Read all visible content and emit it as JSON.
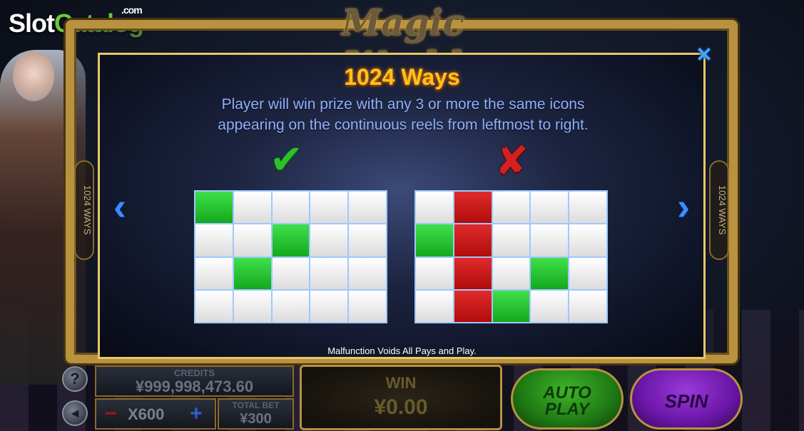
{
  "site_logo": {
    "slot": "Slot",
    "catalog": "Catalog",
    "com": ".com"
  },
  "game": {
    "title": "Magic World"
  },
  "side_label": "1024 WAYS",
  "panel": {
    "close_icon": "×",
    "title": "1024 Ways",
    "description_line1": "Player will win prize with any 3 or more the same icons",
    "description_line2": "appearing on the continuous reels from leftmost to right.",
    "valid_icon": "✔",
    "invalid_icon": "✘",
    "prev_icon": "‹",
    "next_icon": "›",
    "valid_grid": [
      [
        "g",
        "w",
        "w",
        "w",
        "w"
      ],
      [
        "w",
        "w",
        "g",
        "w",
        "w"
      ],
      [
        "w",
        "g",
        "w",
        "w",
        "w"
      ],
      [
        "w",
        "w",
        "w",
        "w",
        "w"
      ]
    ],
    "invalid_grid": [
      [
        "w",
        "r",
        "w",
        "w",
        "w"
      ],
      [
        "g",
        "r",
        "w",
        "w",
        "w"
      ],
      [
        "w",
        "r",
        "w",
        "g",
        "w"
      ],
      [
        "w",
        "r",
        "g",
        "w",
        "w"
      ]
    ],
    "disclaimer": "Malfunction Voids All Pays and Play."
  },
  "controls": {
    "help_icon": "?",
    "sound_icon": "◄",
    "credits_label": "CREDITS",
    "credits_value": "¥999,998,473.60",
    "bet_minus": "−",
    "bet_plus": "+",
    "bet_value": "X600",
    "total_bet_label": "TOTAL BET",
    "total_bet_value": "¥300",
    "win_label": "WIN",
    "win_value": "¥0.00",
    "auto_line1": "AUTO",
    "auto_line2": "PLAY",
    "spin_label": "SPIN"
  },
  "colors": {
    "frame_gold": "#b8923f",
    "title_gold": "#ffc21a",
    "desc_blue": "#8fb0ff",
    "cell_green": "#14a81e",
    "cell_red": "#b10c0c"
  }
}
